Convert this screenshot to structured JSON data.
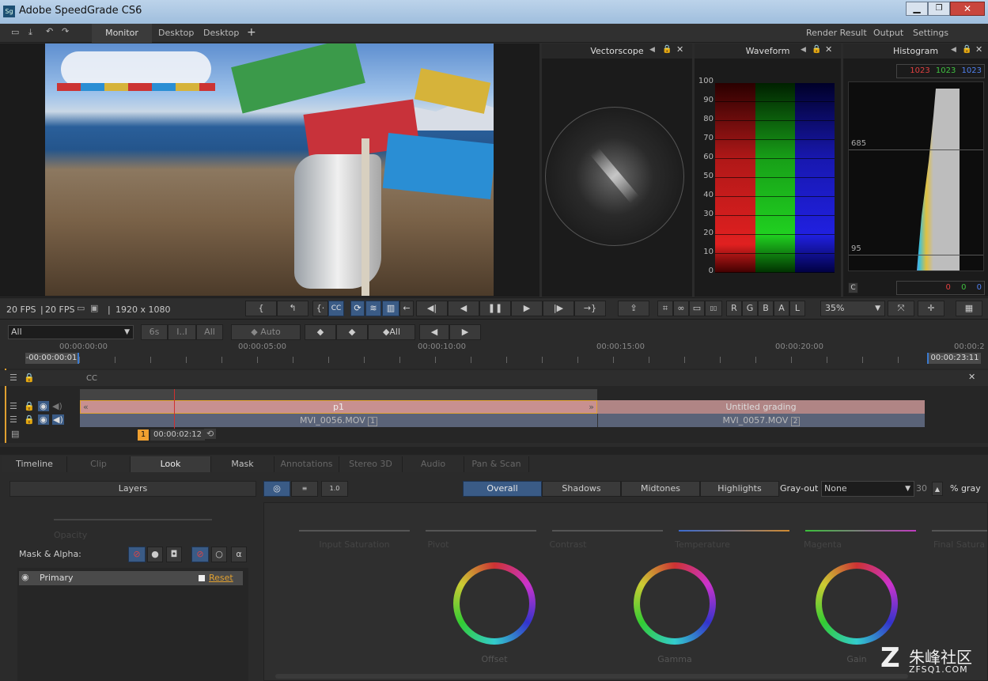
{
  "window": {
    "title": "Adobe SpeedGrade CS6",
    "app_icon": "Sg"
  },
  "menubar": {
    "tabs": [
      "Monitor",
      "Desktop",
      "Desktop"
    ],
    "add": "+",
    "right": [
      "Render Result",
      "Output",
      "Settings"
    ]
  },
  "scopes": {
    "vectorscope": {
      "title": "Vectorscope"
    },
    "waveform": {
      "title": "Waveform",
      "ticks": [
        "100",
        "90",
        "80",
        "70",
        "60",
        "50",
        "40",
        "30",
        "20",
        "10",
        "0"
      ]
    },
    "histogram": {
      "title": "Histogram",
      "top_r": "1023",
      "top_g": "1023",
      "top_b": "1023",
      "mark_high": "685",
      "mark_low": "95",
      "bottom_label": "C",
      "bot_r": "0",
      "bot_g": "0",
      "bot_b": "0"
    }
  },
  "status": {
    "fps": "20 FPS",
    "fps2": "20 FPS",
    "resolution": "1920 x 1080",
    "zoom": "35%"
  },
  "transport": {
    "cc": "CC",
    "channels": [
      "R",
      "G",
      "B",
      "A",
      "L"
    ]
  },
  "keys": {
    "filter": "All",
    "btn_6s": "6s",
    "btn_ii": "I..I",
    "btn_all": "All",
    "auto": "Auto",
    "all2": "All"
  },
  "ruler": {
    "times": [
      "00:00:00:00",
      "00:00:05:00",
      "00:00:10:00",
      "00:00:15:00",
      "00:00:20:00",
      "00:00:2"
    ],
    "in": "-00:00:00:01",
    "out": "00:00:23:11"
  },
  "tracks": {
    "cc_label": "CC",
    "grade1": "p1",
    "grade2": "Untitled grading",
    "clip1": "MVI_0056.MOV",
    "clip1_num": "1",
    "clip2": "MVI_0057.MOV",
    "clip2_num": "2",
    "marker_num": "1",
    "marker_time": "00:00:02:12"
  },
  "tabs": {
    "items": [
      "Timeline",
      "Clip",
      "Look",
      "Mask",
      "Annotations",
      "Stereo 3D",
      "Audio",
      "Pan & Scan"
    ]
  },
  "layers": {
    "title": "Layers",
    "opacity": "Opacity",
    "mask_alpha": "Mask & Alpha:",
    "primary": "Primary",
    "reset": "Reset"
  },
  "look": {
    "ranges": [
      "Overall",
      "Shadows",
      "Midtones",
      "Highlights"
    ],
    "grayout_label": "Gray-out",
    "grayout_value": "None",
    "gray_value": "30",
    "gray_unit": "% gray",
    "sliders": [
      "Input Saturation",
      "Pivot",
      "Contrast",
      "Temperature",
      "Magenta",
      "Final Satura"
    ],
    "wheels": [
      "Offset",
      "Gamma",
      "Gain"
    ]
  },
  "watermark": {
    "text": "朱峰社区",
    "url": "ZFSQ1.COM"
  },
  "colors": {
    "accent": "#3a5b86",
    "orange": "#f0a030",
    "grade_pink": "#c08a8a"
  }
}
